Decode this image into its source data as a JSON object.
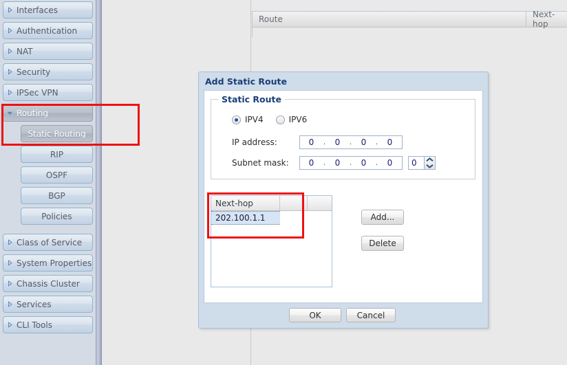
{
  "sidebar": {
    "items": [
      {
        "label": "Interfaces",
        "type": "parent",
        "state": "collapsed",
        "icon": "triangle-right-icon"
      },
      {
        "label": "Authentication",
        "type": "parent",
        "state": "collapsed",
        "icon": "triangle-right-icon"
      },
      {
        "label": "NAT",
        "type": "parent",
        "state": "collapsed",
        "icon": "triangle-right-icon"
      },
      {
        "label": "Security",
        "type": "parent",
        "state": "collapsed",
        "icon": "triangle-right-icon"
      },
      {
        "label": "IPSec VPN",
        "type": "parent",
        "state": "collapsed",
        "icon": "triangle-right-icon"
      },
      {
        "label": "Routing",
        "type": "parent",
        "state": "expanded",
        "icon": "triangle-down-icon"
      },
      {
        "label": "Static Routing",
        "type": "child",
        "state": "selected"
      },
      {
        "label": "RIP",
        "type": "child",
        "state": "normal"
      },
      {
        "label": "OSPF",
        "type": "child",
        "state": "normal"
      },
      {
        "label": "BGP",
        "type": "child",
        "state": "normal"
      },
      {
        "label": "Policies",
        "type": "child",
        "state": "normal"
      },
      {
        "label": "Class of Service",
        "type": "parent",
        "state": "collapsed",
        "icon": "triangle-right-icon"
      },
      {
        "label": "System Properties",
        "type": "parent",
        "state": "collapsed",
        "icon": "triangle-right-icon"
      },
      {
        "label": "Chassis Cluster",
        "type": "parent",
        "state": "collapsed",
        "icon": "triangle-right-icon"
      },
      {
        "label": "Services",
        "type": "parent",
        "state": "collapsed",
        "icon": "triangle-right-icon"
      },
      {
        "label": "CLI Tools",
        "type": "parent",
        "state": "collapsed",
        "icon": "triangle-right-icon"
      }
    ]
  },
  "route_table": {
    "columns": [
      "Route",
      "Next-hop"
    ],
    "rows": []
  },
  "dialog": {
    "title": "Add Static Route",
    "group": {
      "legend": "Static Route",
      "ip_version": {
        "selected": "IPV4",
        "options": [
          "IPV4",
          "IPV6"
        ]
      },
      "ip_address": {
        "label": "IP address:",
        "octets": [
          "0",
          "0",
          "0",
          "0"
        ],
        "separator": "."
      },
      "subnet_mask": {
        "label": "Subnet mask:",
        "octets": [
          "0",
          "0",
          "0",
          "0"
        ],
        "separator": ".",
        "prefix_value": "0"
      }
    },
    "nexthop_list": {
      "columns": [
        "Next-hop",
        "",
        ""
      ],
      "rows": [
        {
          "nexthop": "202.100.1.1",
          "selected": true
        }
      ]
    },
    "buttons": {
      "add": "Add...",
      "delete": "Delete",
      "ok": "OK",
      "cancel": "Cancel"
    }
  },
  "annotations": {
    "highlight_color": "#ee1111",
    "boxes": [
      "routing-static-routing-nav",
      "nexthop-entry"
    ]
  }
}
